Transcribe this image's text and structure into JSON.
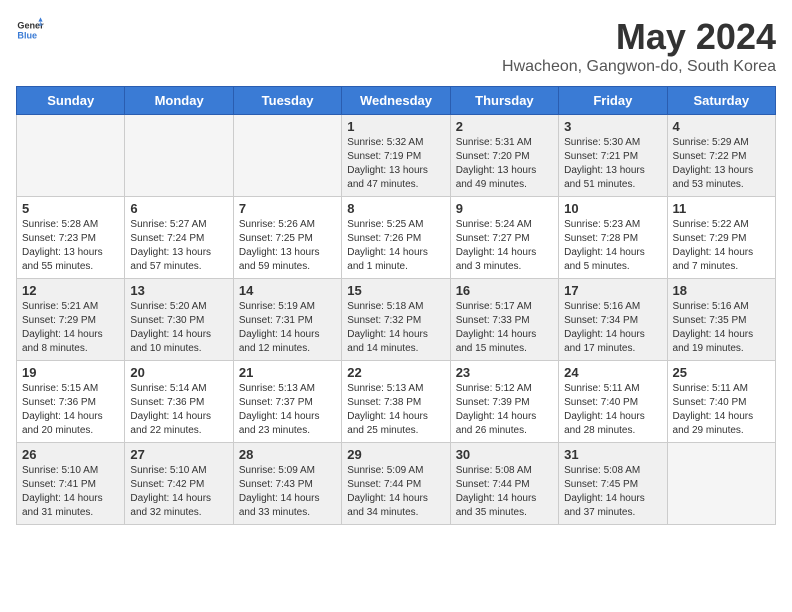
{
  "header": {
    "logo_general": "General",
    "logo_blue": "Blue",
    "month_year": "May 2024",
    "location": "Hwacheon, Gangwon-do, South Korea"
  },
  "days_of_week": [
    "Sunday",
    "Monday",
    "Tuesday",
    "Wednesday",
    "Thursday",
    "Friday",
    "Saturday"
  ],
  "weeks": [
    [
      {
        "day": "",
        "info": ""
      },
      {
        "day": "",
        "info": ""
      },
      {
        "day": "",
        "info": ""
      },
      {
        "day": "1",
        "info": "Sunrise: 5:32 AM\nSunset: 7:19 PM\nDaylight: 13 hours\nand 47 minutes."
      },
      {
        "day": "2",
        "info": "Sunrise: 5:31 AM\nSunset: 7:20 PM\nDaylight: 13 hours\nand 49 minutes."
      },
      {
        "day": "3",
        "info": "Sunrise: 5:30 AM\nSunset: 7:21 PM\nDaylight: 13 hours\nand 51 minutes."
      },
      {
        "day": "4",
        "info": "Sunrise: 5:29 AM\nSunset: 7:22 PM\nDaylight: 13 hours\nand 53 minutes."
      }
    ],
    [
      {
        "day": "5",
        "info": "Sunrise: 5:28 AM\nSunset: 7:23 PM\nDaylight: 13 hours\nand 55 minutes."
      },
      {
        "day": "6",
        "info": "Sunrise: 5:27 AM\nSunset: 7:24 PM\nDaylight: 13 hours\nand 57 minutes."
      },
      {
        "day": "7",
        "info": "Sunrise: 5:26 AM\nSunset: 7:25 PM\nDaylight: 13 hours\nand 59 minutes."
      },
      {
        "day": "8",
        "info": "Sunrise: 5:25 AM\nSunset: 7:26 PM\nDaylight: 14 hours\nand 1 minute."
      },
      {
        "day": "9",
        "info": "Sunrise: 5:24 AM\nSunset: 7:27 PM\nDaylight: 14 hours\nand 3 minutes."
      },
      {
        "day": "10",
        "info": "Sunrise: 5:23 AM\nSunset: 7:28 PM\nDaylight: 14 hours\nand 5 minutes."
      },
      {
        "day": "11",
        "info": "Sunrise: 5:22 AM\nSunset: 7:29 PM\nDaylight: 14 hours\nand 7 minutes."
      }
    ],
    [
      {
        "day": "12",
        "info": "Sunrise: 5:21 AM\nSunset: 7:29 PM\nDaylight: 14 hours\nand 8 minutes."
      },
      {
        "day": "13",
        "info": "Sunrise: 5:20 AM\nSunset: 7:30 PM\nDaylight: 14 hours\nand 10 minutes."
      },
      {
        "day": "14",
        "info": "Sunrise: 5:19 AM\nSunset: 7:31 PM\nDaylight: 14 hours\nand 12 minutes."
      },
      {
        "day": "15",
        "info": "Sunrise: 5:18 AM\nSunset: 7:32 PM\nDaylight: 14 hours\nand 14 minutes."
      },
      {
        "day": "16",
        "info": "Sunrise: 5:17 AM\nSunset: 7:33 PM\nDaylight: 14 hours\nand 15 minutes."
      },
      {
        "day": "17",
        "info": "Sunrise: 5:16 AM\nSunset: 7:34 PM\nDaylight: 14 hours\nand 17 minutes."
      },
      {
        "day": "18",
        "info": "Sunrise: 5:16 AM\nSunset: 7:35 PM\nDaylight: 14 hours\nand 19 minutes."
      }
    ],
    [
      {
        "day": "19",
        "info": "Sunrise: 5:15 AM\nSunset: 7:36 PM\nDaylight: 14 hours\nand 20 minutes."
      },
      {
        "day": "20",
        "info": "Sunrise: 5:14 AM\nSunset: 7:36 PM\nDaylight: 14 hours\nand 22 minutes."
      },
      {
        "day": "21",
        "info": "Sunrise: 5:13 AM\nSunset: 7:37 PM\nDaylight: 14 hours\nand 23 minutes."
      },
      {
        "day": "22",
        "info": "Sunrise: 5:13 AM\nSunset: 7:38 PM\nDaylight: 14 hours\nand 25 minutes."
      },
      {
        "day": "23",
        "info": "Sunrise: 5:12 AM\nSunset: 7:39 PM\nDaylight: 14 hours\nand 26 minutes."
      },
      {
        "day": "24",
        "info": "Sunrise: 5:11 AM\nSunset: 7:40 PM\nDaylight: 14 hours\nand 28 minutes."
      },
      {
        "day": "25",
        "info": "Sunrise: 5:11 AM\nSunset: 7:40 PM\nDaylight: 14 hours\nand 29 minutes."
      }
    ],
    [
      {
        "day": "26",
        "info": "Sunrise: 5:10 AM\nSunset: 7:41 PM\nDaylight: 14 hours\nand 31 minutes."
      },
      {
        "day": "27",
        "info": "Sunrise: 5:10 AM\nSunset: 7:42 PM\nDaylight: 14 hours\nand 32 minutes."
      },
      {
        "day": "28",
        "info": "Sunrise: 5:09 AM\nSunset: 7:43 PM\nDaylight: 14 hours\nand 33 minutes."
      },
      {
        "day": "29",
        "info": "Sunrise: 5:09 AM\nSunset: 7:44 PM\nDaylight: 14 hours\nand 34 minutes."
      },
      {
        "day": "30",
        "info": "Sunrise: 5:08 AM\nSunset: 7:44 PM\nDaylight: 14 hours\nand 35 minutes."
      },
      {
        "day": "31",
        "info": "Sunrise: 5:08 AM\nSunset: 7:45 PM\nDaylight: 14 hours\nand 37 minutes."
      },
      {
        "day": "",
        "info": ""
      }
    ]
  ]
}
